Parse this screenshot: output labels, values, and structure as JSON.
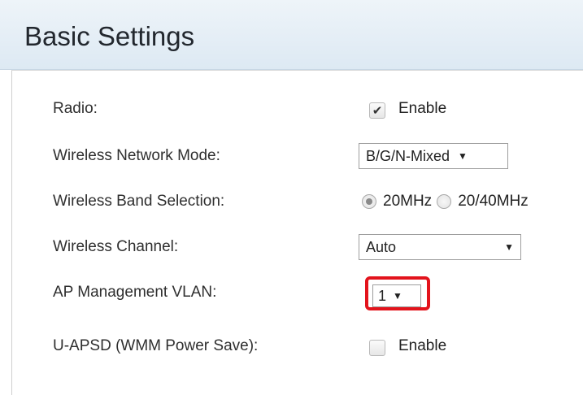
{
  "page": {
    "title": "Basic Settings"
  },
  "settings": {
    "radio": {
      "label": "Radio:",
      "checkbox_label": "Enable",
      "checked": true
    },
    "network_mode": {
      "label": "Wireless Network Mode:",
      "value": "B/G/N-Mixed"
    },
    "band": {
      "label": "Wireless Band Selection:",
      "options": [
        "20MHz",
        "20/40MHz"
      ],
      "selected": "20MHz"
    },
    "channel": {
      "label": "Wireless Channel:",
      "value": "Auto"
    },
    "vlan": {
      "label": "AP Management VLAN:",
      "value": "1",
      "highlight_color": "#e3131c"
    },
    "uapsd": {
      "label": "U-APSD (WMM Power Save):",
      "checkbox_label": "Enable",
      "checked": false
    }
  },
  "icons": {
    "checkmark": "check-icon",
    "dropdown": "chevron-down-icon"
  }
}
